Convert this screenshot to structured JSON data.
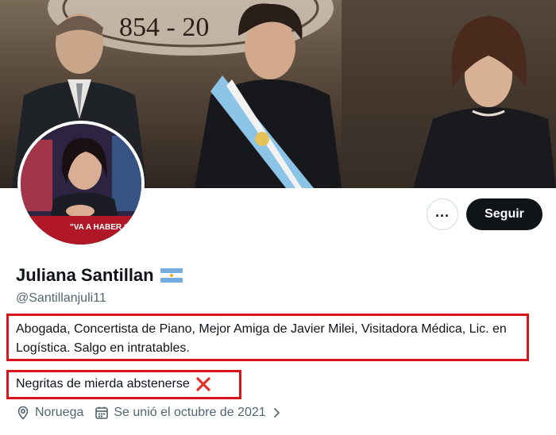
{
  "profile": {
    "name": "Juliana Santillan",
    "handle": "@Santillanjuli11",
    "bio": "Abogada, Concertista de Piano, Mejor Amiga de Javier Milei, Visitadora Médica, Lic. en Logística. Salgo en intratables.",
    "tagline": "Negritas de mierda abstenerse",
    "location": "Noruega",
    "joined": "Se unió el octubre de 2021"
  },
  "banner": {
    "text": "854 - 20"
  },
  "avatar": {
    "caption": "\"VA A HABER CA"
  },
  "actions": {
    "more_label": "...",
    "follow_label": "Seguir"
  },
  "icons": {
    "more": "more-dots-icon",
    "location": "location-pin-icon",
    "calendar": "calendar-icon",
    "chevron": "chevron-right-icon",
    "flag": "argentina-flag-icon",
    "cross": "red-cross-icon"
  },
  "colors": {
    "highlight": "#d6141c",
    "button": "#0f1419",
    "secondary_text": "#536471"
  }
}
